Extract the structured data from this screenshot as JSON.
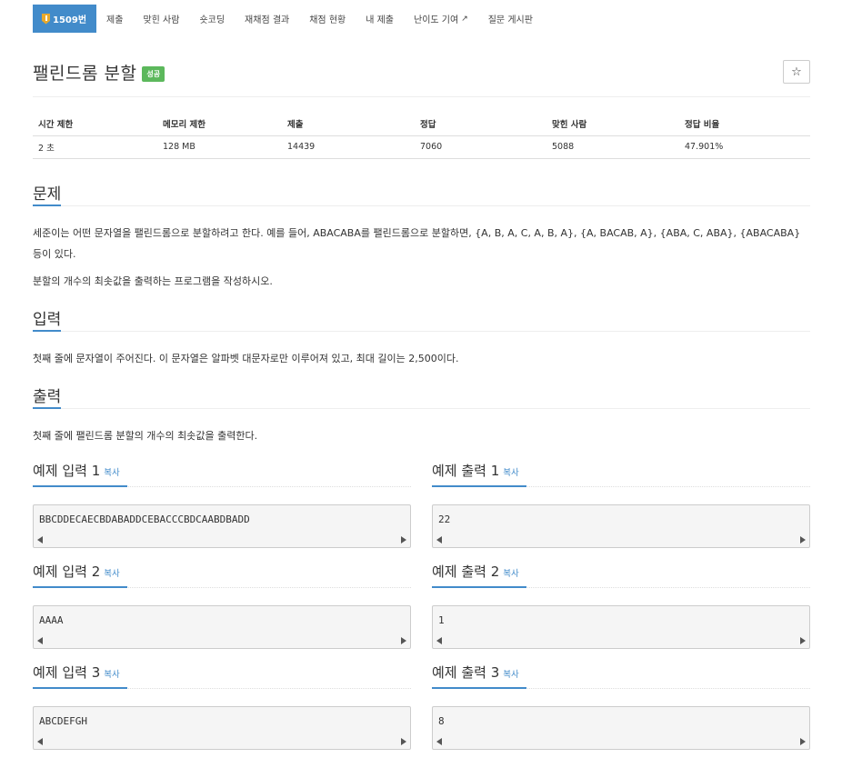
{
  "nav": {
    "items": [
      {
        "label": "1509번",
        "active": true
      },
      {
        "label": "제출"
      },
      {
        "label": "맞힌 사람"
      },
      {
        "label": "숏코딩"
      },
      {
        "label": "재채점 결과"
      },
      {
        "label": "채점 현황"
      },
      {
        "label": "내 제출"
      },
      {
        "label": "난이도 기여"
      },
      {
        "label": "질문 게시판"
      }
    ]
  },
  "problem": {
    "title": "팰린드롬 분할",
    "result_label": "성공",
    "star": "☆"
  },
  "info": {
    "headers": [
      "시간 제한",
      "메모리 제한",
      "제출",
      "정답",
      "맞힌 사람",
      "정답 비율"
    ],
    "values": [
      "2 초",
      "128 MB",
      "14439",
      "7060",
      "5088",
      "47.901%"
    ]
  },
  "sections": {
    "description": {
      "title": "문제",
      "p1_line1": "세준이는 어떤 문자열을 팰린드롬으로 분할하려고 한다. 예를 들어, ABACABA를 팰린드롬으로 분할하면, {A, B, A, C, A, B, A}, {A, BACAB, A}, {ABA, C, ABA}, {ABACABA}",
      "p1_line2": "등이 있다.",
      "p2": "분할의 개수의 최솟값을 출력하는 프로그램을 작성하시오."
    },
    "input": {
      "title": "입력",
      "text": "첫째 줄에 문자열이 주어진다. 이 문자열은 알파벳 대문자로만 이루어져 있고, 최대 길이는 2,500이다."
    },
    "output": {
      "title": "출력",
      "text": "첫째 줄에 팰린드롬 분할의 개수의 최솟값을 출력한다."
    }
  },
  "samples": {
    "copy_label": "복사",
    "inputs": [
      {
        "title": "예제 입력 1",
        "data": "BBCDDECAECBDABADDCEBACCCBDCAABDBADD"
      },
      {
        "title": "예제 입력 2",
        "data": "AAAA"
      },
      {
        "title": "예제 입력 3",
        "data": "ABCDEFGH"
      }
    ],
    "outputs": [
      {
        "title": "예제 출력 1",
        "data": "22"
      },
      {
        "title": "예제 출력 2",
        "data": "1"
      },
      {
        "title": "예제 출력 3",
        "data": "8"
      }
    ]
  },
  "colors": {
    "accent": "#428bca",
    "success": "#5cb85c",
    "badge": "#e8a92b"
  }
}
